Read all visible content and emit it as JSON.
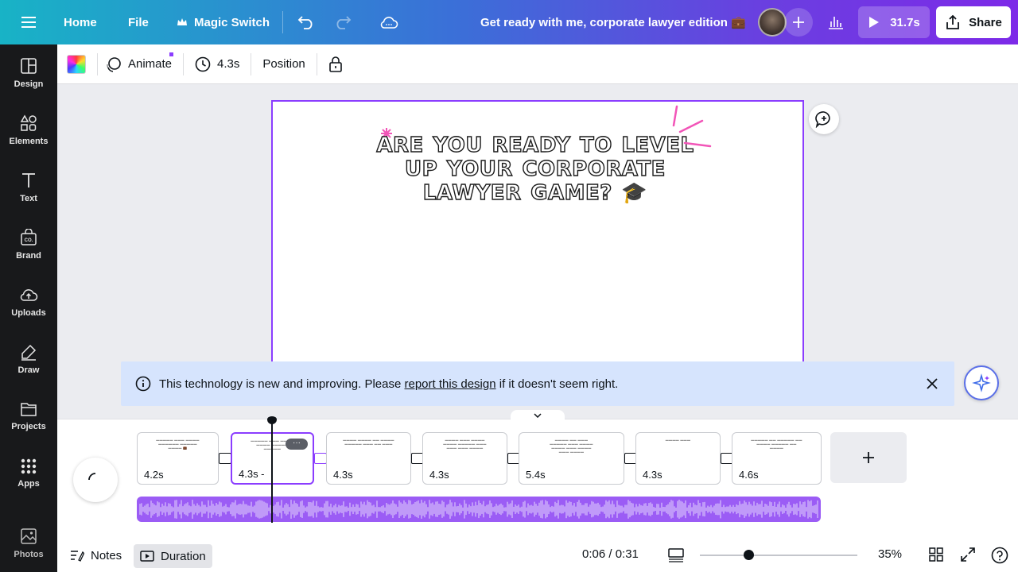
{
  "topbar": {
    "menu_icon": "hamburger-icon",
    "home": "Home",
    "file": "File",
    "magic_switch": "Magic Switch",
    "title": "Get ready with me, corporate lawyer edition 💼",
    "play_duration": "31.7s",
    "share": "Share"
  },
  "sidebar": {
    "items": [
      {
        "label": "Design",
        "icon": "design-icon"
      },
      {
        "label": "Elements",
        "icon": "elements-icon"
      },
      {
        "label": "Text",
        "icon": "text-icon"
      },
      {
        "label": "Brand",
        "icon": "brand-icon"
      },
      {
        "label": "Uploads",
        "icon": "uploads-icon"
      },
      {
        "label": "Draw",
        "icon": "draw-icon"
      },
      {
        "label": "Projects",
        "icon": "projects-icon"
      },
      {
        "label": "Apps",
        "icon": "apps-icon"
      },
      {
        "label": "Photos",
        "icon": "photos-icon"
      }
    ]
  },
  "toolbar": {
    "animate": "Animate",
    "duration": "4.3s",
    "position": "Position"
  },
  "canvas": {
    "headline": "ARE YOU READY TO LEVEL UP YOUR CORPORATE LAWYER GAME? 🎓"
  },
  "banner": {
    "text_before": "This technology is new and improving. Please ",
    "link": "report this design",
    "text_after": " if it doesn't seem right."
  },
  "timeline": {
    "pages": [
      {
        "duration": "4.2s",
        "selected": false
      },
      {
        "duration": "4.3s -",
        "selected": true
      },
      {
        "duration": "4.3s",
        "selected": false
      },
      {
        "duration": "4.3s",
        "selected": false
      },
      {
        "duration": "5.4s",
        "selected": false
      },
      {
        "duration": "4.3s",
        "selected": false
      },
      {
        "duration": "4.6s",
        "selected": false
      }
    ],
    "selected_page_menu": "···"
  },
  "bottombar": {
    "notes": "Notes",
    "duration": "Duration",
    "time": "0:06 / 0:31",
    "zoom": "35%",
    "zoom_level": 0.35
  },
  "colors": {
    "accent": "#8b3dff",
    "sidebar_bg": "#18191b",
    "banner_bg": "#d6e4fd",
    "audio_track": "#9b5cf5",
    "decor_pink": "#f255b8"
  }
}
